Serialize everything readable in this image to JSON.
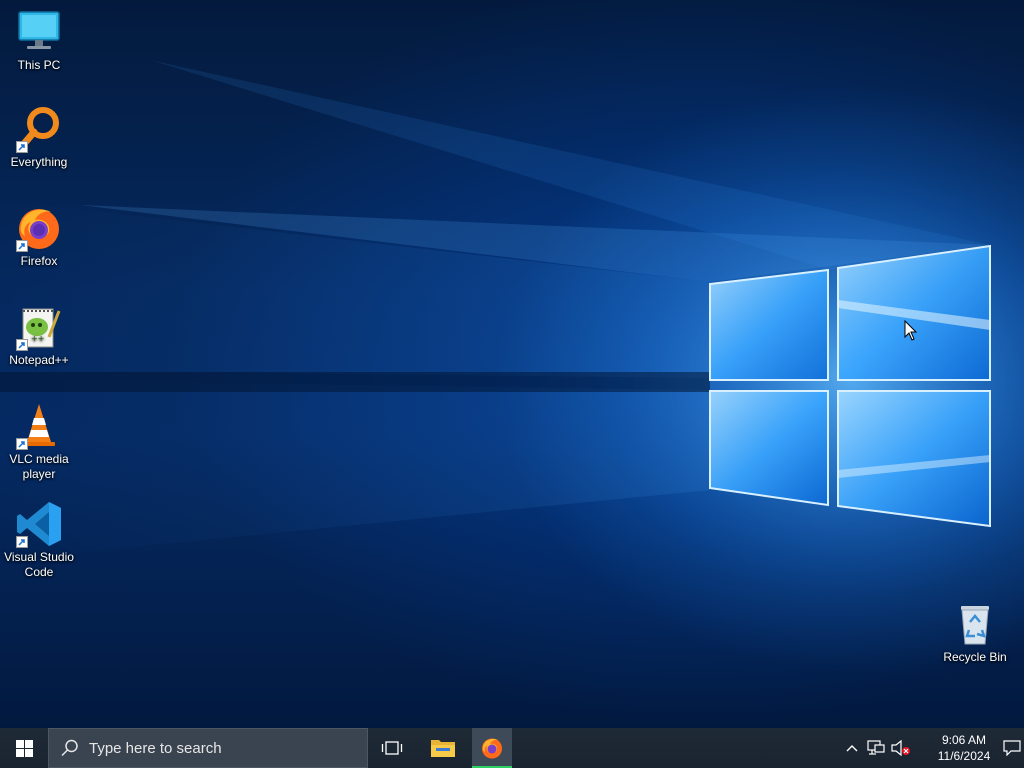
{
  "desktop": {
    "icons": [
      {
        "label": "This PC",
        "icon": "this-pc-icon",
        "shortcut": false
      },
      {
        "label": "Everything",
        "icon": "everything-icon",
        "shortcut": true
      },
      {
        "label": "Firefox",
        "icon": "firefox-icon",
        "shortcut": true
      },
      {
        "label": "Notepad++",
        "icon": "notepadpp-icon",
        "shortcut": true
      },
      {
        "label": "VLC media player",
        "icon": "vlc-icon",
        "shortcut": true
      },
      {
        "label": "Visual Studio Code",
        "icon": "vscode-icon",
        "shortcut": true
      }
    ],
    "recycle_bin": {
      "label": "Recycle Bin",
      "icon": "recycle-bin-icon"
    }
  },
  "taskbar": {
    "start_icon": "windows-logo-icon",
    "search": {
      "placeholder": "Type here to search",
      "icon": "search-icon"
    },
    "task_view_icon": "task-view-icon",
    "pinned": [
      {
        "name": "File Explorer",
        "icon": "folder-icon",
        "active": false
      },
      {
        "name": "Firefox",
        "icon": "firefox-icon",
        "active": true
      }
    ],
    "tray": {
      "chevron_icon": "chevron-up-icon",
      "network_icon": "network-icon",
      "volume_icon": "volume-muted-icon",
      "time": "9:06 AM",
      "date": "11/6/2024",
      "notifications_icon": "notifications-icon"
    }
  },
  "colors": {
    "taskbar_bg": "#1f2a37",
    "active_indicator": "#2fd063",
    "wallpaper_glow": "#2896ff"
  }
}
